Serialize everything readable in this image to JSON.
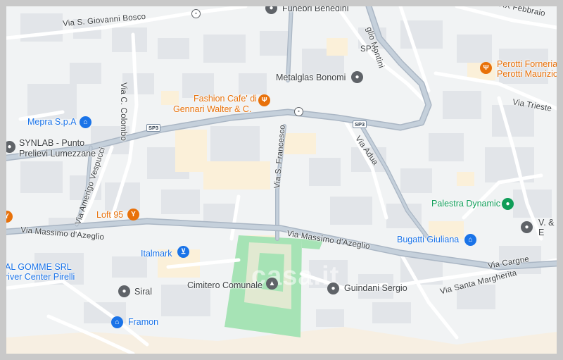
{
  "roads": {
    "via_s_giovanni_bosco": "Via S. Giovanni Bosco",
    "via_montini": "glio Montini",
    "sp3_a": "SP3",
    "sp3_b": "SP3",
    "sp3_c": "SP3",
    "via_febbraio": "Via XX Febbraio",
    "via_trieste": "Via Trieste",
    "via_colombo": "Via C. Colombo",
    "via_adua": "Via Adua",
    "via_s_francesco": "Via S. Francesco",
    "via_amerigo_vespucci": "Via Amerigo Vespucci",
    "via_massimo_dazeglio_w": "Via Massimo d'Azeglio",
    "via_massimo_dazeglio_e": "Via Massimo d'Azeglio",
    "via_cargne": "Via Cargne",
    "via_santa_margherita": "Via Santa Margherita"
  },
  "places": {
    "funebri": "Funebri Benedini",
    "metalglas": "Metalglas Bonomi",
    "fashion_cafe_1": "Fashion Cafe' di",
    "fashion_cafe_2": "Gennari Walter & C.",
    "perotti_1": "Perotti Forneria",
    "perotti_2": "Perotti Maurizio",
    "mepra": "Mepra S.p.A",
    "synlab_1": "SYNLAB - Punto",
    "synlab_2": "Prelievi Lumezzane",
    "loft95": "Loft 95",
    "palestra": "Palestra Dynamic",
    "vb_1": "V. & P.",
    "vb_2": "E",
    "bugatti": "Bugatti Giuliana",
    "italmark": "Italmark",
    "al_gomme_1": "AL GOMME SRL",
    "al_gomme_2": "river Center Pirelli",
    "siral": "Siral",
    "cimitero": "Cimitero Comunale",
    "guindani": "Guindani Sergio",
    "framon": "Framon"
  },
  "watermark": "casa.it",
  "colors": {
    "background": "#f1f3f4",
    "road": "#ffffff",
    "major_road": "#aab6c4",
    "building": "#e3e6ea",
    "highlight_building": "#fbf0d9",
    "park": "#a6e3b5",
    "poi_blue": "#1a73e8",
    "poi_orange": "#e8710a",
    "poi_green": "#0f9d58",
    "poi_gray": "#5f6368"
  },
  "icons": {
    "restaurant": "fork-knife-icon",
    "shopping": "shopping-bag-icon",
    "cart": "shopping-cart-icon",
    "bar": "cocktail-icon",
    "place": "map-pin-icon",
    "gym": "dumbbell-icon",
    "bus": "bus-stop-icon",
    "cemetery": "cemetery-icon"
  }
}
